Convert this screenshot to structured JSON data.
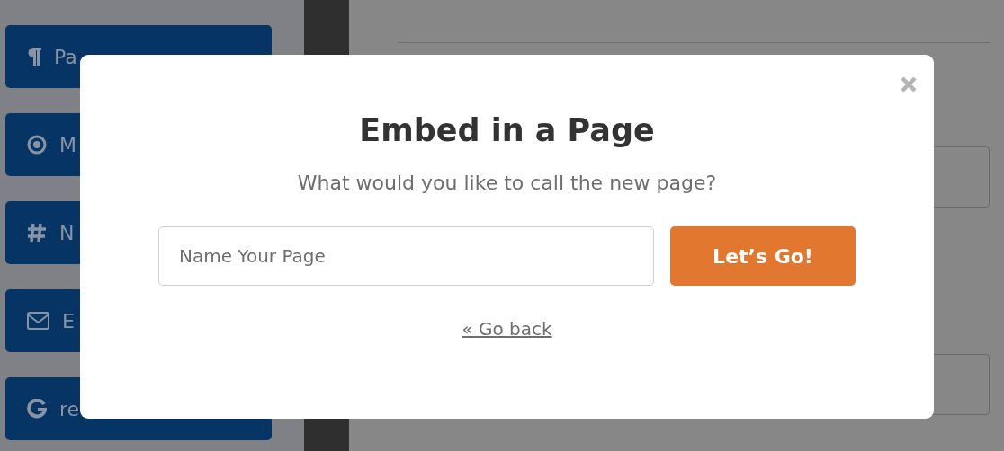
{
  "sidebar": {
    "buttons": [
      {
        "kind": "paragraph",
        "label": "Pa"
      },
      {
        "kind": "radio",
        "label": "M"
      },
      {
        "kind": "number",
        "label": "N"
      },
      {
        "kind": "email",
        "label": "E"
      },
      {
        "kind": "google",
        "label": "re"
      }
    ]
  },
  "dialog": {
    "title": "Embed in a Page",
    "prompt": "What would you like to call the new page?",
    "input": {
      "placeholder": "Name Your Page"
    },
    "submit": "Let’s Go!",
    "back_link": "« Go back"
  }
}
